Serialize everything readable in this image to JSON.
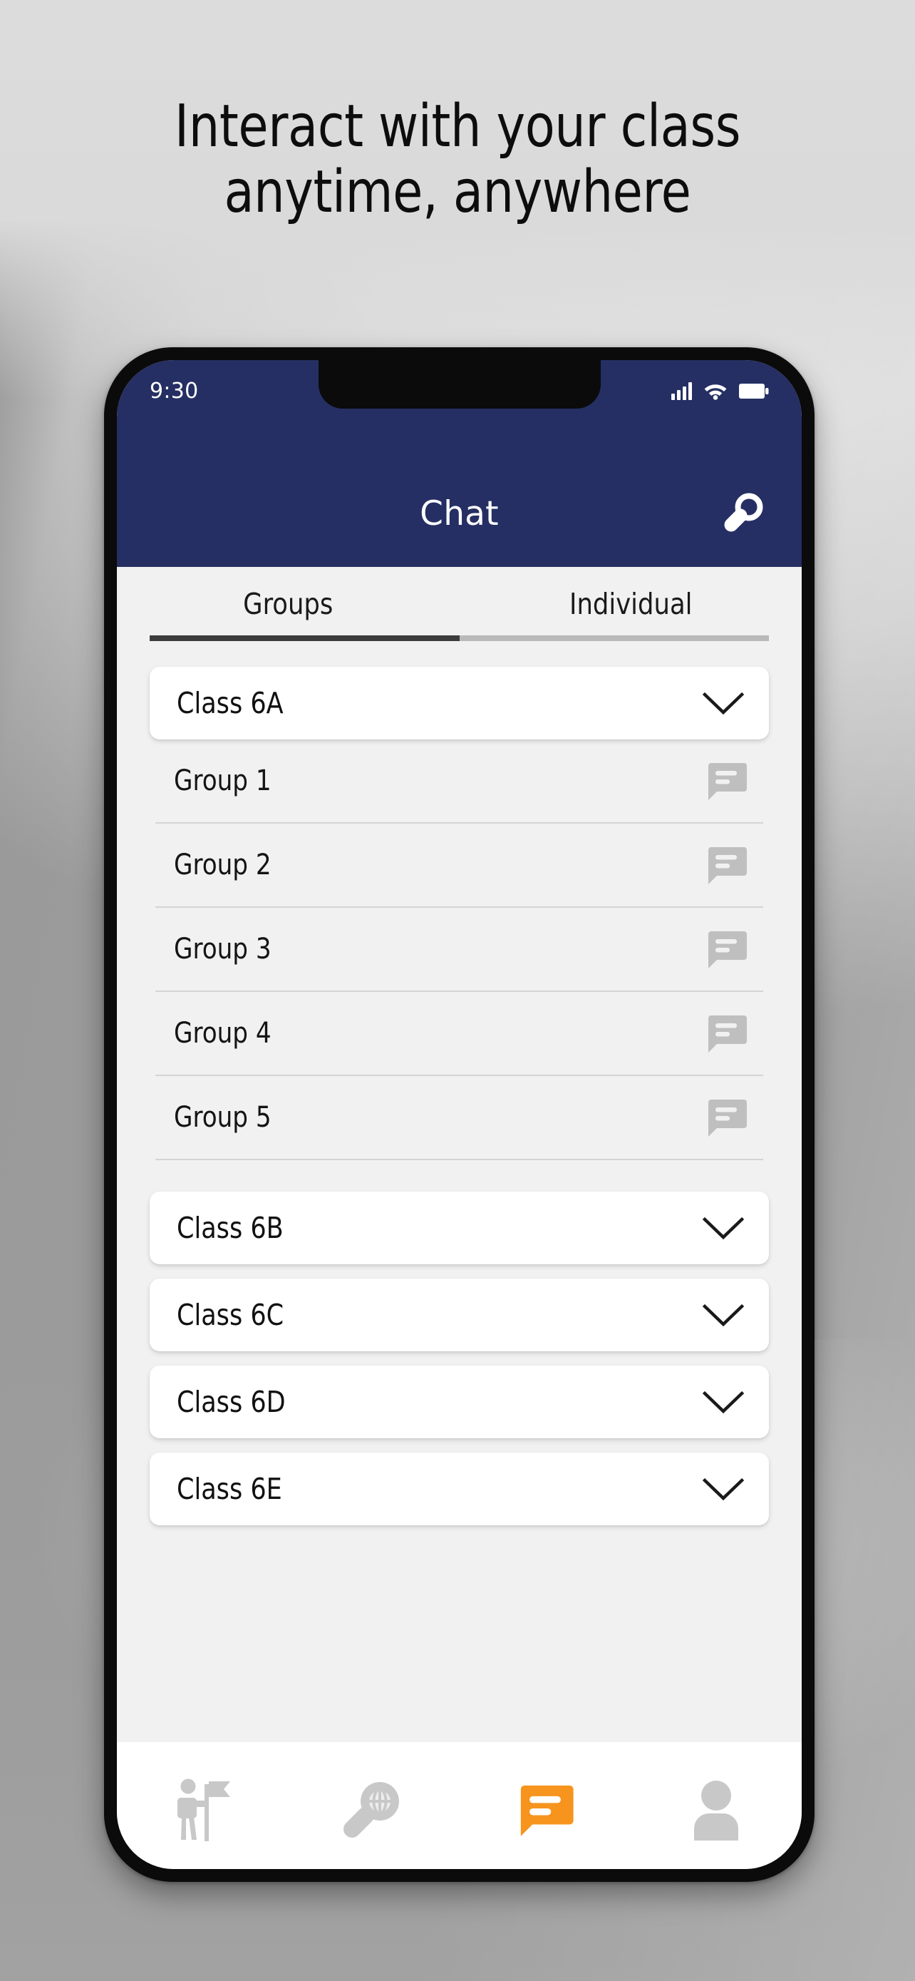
{
  "page": {
    "headline_line1": "Interact with your class",
    "headline_line2": "anytime, anywhere",
    "background_color": "#d6d6d6"
  },
  "phone": {
    "status_bar": {
      "time": "9:30",
      "signal_icon": "cellular-signal-icon",
      "wifi_icon": "wifi-icon",
      "battery_icon": "battery-icon"
    },
    "header": {
      "title": "Chat",
      "background_color": "#252f63",
      "search_icon": "search-icon"
    },
    "tabs": {
      "active_index": 0,
      "items": [
        {
          "label": "Groups",
          "active": true
        },
        {
          "label": "Individual",
          "active": false
        }
      ],
      "active_underline_color": "#3c3c3c",
      "inactive_underline_color": "#b9b9b9"
    },
    "classes": [
      {
        "label": "Class 6A",
        "expanded": true,
        "chevron_icon": "chevron-down-icon",
        "groups": [
          {
            "label": "Group 1",
            "icon": "chat-bubble-icon"
          },
          {
            "label": "Group 2",
            "icon": "chat-bubble-icon"
          },
          {
            "label": "Group 3",
            "icon": "chat-bubble-icon"
          },
          {
            "label": "Group 4",
            "icon": "chat-bubble-icon"
          },
          {
            "label": "Group 5",
            "icon": "chat-bubble-icon"
          }
        ]
      },
      {
        "label": "Class 6B",
        "expanded": false,
        "chevron_icon": "chevron-down-icon",
        "groups": []
      },
      {
        "label": "Class 6C",
        "expanded": false,
        "chevron_icon": "chevron-down-icon",
        "groups": []
      },
      {
        "label": "Class 6D",
        "expanded": false,
        "chevron_icon": "chevron-down-icon",
        "groups": []
      },
      {
        "label": "Class 6E",
        "expanded": false,
        "chevron_icon": "chevron-down-icon",
        "groups": []
      }
    ],
    "bottom_nav": {
      "active_index": 2,
      "active_color": "#f7941e",
      "inactive_color": "#c8c8c8",
      "items": [
        {
          "icon": "tour-guide-icon",
          "active": false
        },
        {
          "icon": "globe-search-icon",
          "active": false
        },
        {
          "icon": "chat-bubble-icon",
          "active": true
        },
        {
          "icon": "profile-icon",
          "active": false
        }
      ]
    }
  }
}
